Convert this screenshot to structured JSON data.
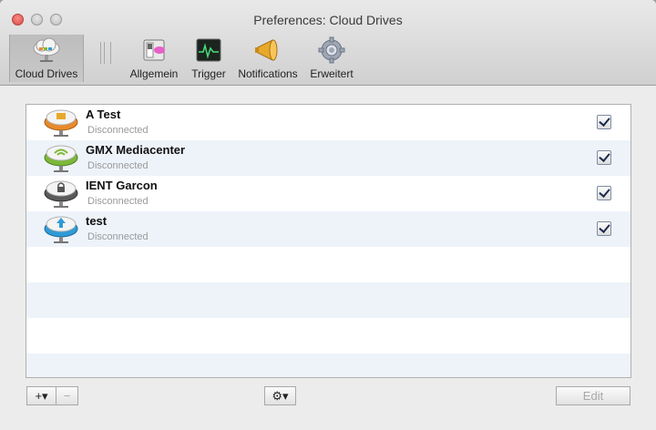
{
  "window": {
    "title": "Preferences: Cloud Drives"
  },
  "toolbar": {
    "items": [
      {
        "label": "Cloud Drives",
        "icon": "cloud-drives-icon",
        "selected": true
      },
      {
        "label": "Allgemein",
        "icon": "switch-icon"
      },
      {
        "label": "Trigger",
        "icon": "activity-monitor-icon"
      },
      {
        "label": "Notifications",
        "icon": "megaphone-icon"
      },
      {
        "label": "Erweitert",
        "icon": "gear-icon"
      }
    ]
  },
  "drives": [
    {
      "name": "A Test",
      "status": "Disconnected",
      "checked": true,
      "color": "#e88a2a",
      "icon": "folder-cloud-icon"
    },
    {
      "name": "GMX Mediacenter",
      "status": "Disconnected",
      "checked": true,
      "color": "#7cb83a",
      "icon": "wifi-cloud-icon"
    },
    {
      "name": "IENT Garcon",
      "status": "Disconnected",
      "checked": true,
      "color": "#6a6a6a",
      "icon": "lock-cloud-icon"
    },
    {
      "name": "test",
      "status": "Disconnected",
      "checked": true,
      "color": "#2f9bd6",
      "icon": "upload-cloud-icon"
    }
  ],
  "footer": {
    "add_label": "+▾",
    "remove_label": "−",
    "action_label": "⚙▾",
    "edit_label": "Edit"
  }
}
